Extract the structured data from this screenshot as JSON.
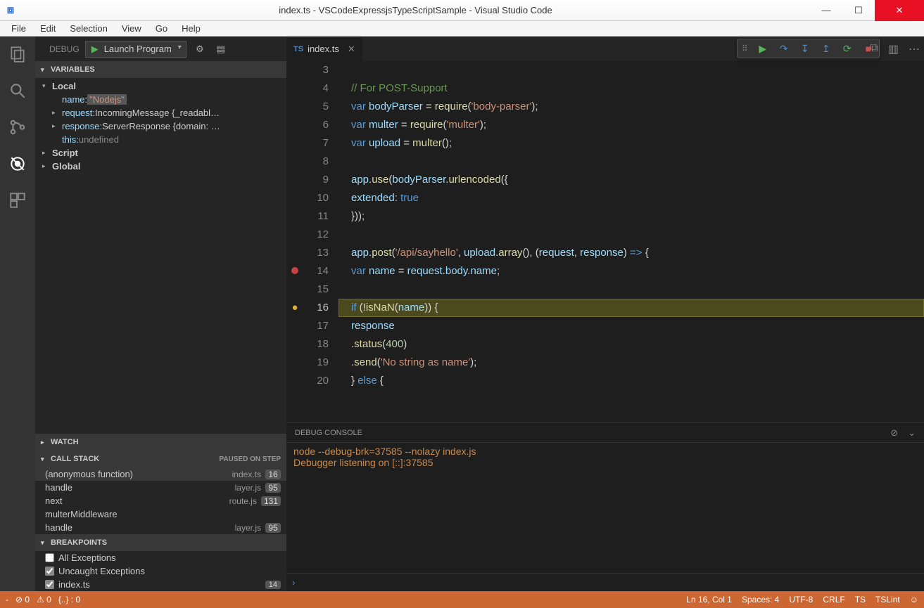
{
  "window": {
    "title": "index.ts - VSCodeExpressjsTypeScriptSample - Visual Studio Code"
  },
  "menu": [
    "File",
    "Edit",
    "Selection",
    "View",
    "Go",
    "Help"
  ],
  "debugTop": {
    "label": "DEBUG",
    "config": "Launch Program"
  },
  "sections": {
    "variables": "VARIABLES",
    "watch": "WATCH",
    "callstack": "CALL STACK",
    "callstack_state": "PAUSED ON STEP",
    "breakpoints": "BREAKPOINTS"
  },
  "variables": {
    "local_label": "Local",
    "rows": [
      {
        "indent": 2,
        "key": "name:",
        "val": "\"Nodejs\"",
        "hl": true
      },
      {
        "indent": 1,
        "chev": true,
        "key": "request:",
        "obj": "IncomingMessage {_readabl…"
      },
      {
        "indent": 1,
        "chev": true,
        "key": "response:",
        "obj": "ServerResponse {domain: …"
      },
      {
        "indent": 2,
        "key": "this:",
        "undef": "undefined"
      }
    ],
    "script_label": "Script",
    "global_label": "Global"
  },
  "callstack": [
    {
      "name": "(anonymous function)",
      "file": "index.ts",
      "line": "16",
      "active": true
    },
    {
      "name": "handle",
      "file": "layer.js",
      "line": "95"
    },
    {
      "name": "next",
      "file": "route.js",
      "line": "131"
    },
    {
      "name": "multerMiddleware",
      "file": "",
      "line": ""
    },
    {
      "name": "handle",
      "file": "layer.js",
      "line": "95"
    }
  ],
  "breakpoints": [
    {
      "label": "All Exceptions",
      "checked": false
    },
    {
      "label": "Uncaught Exceptions",
      "checked": true
    },
    {
      "label": "index.ts",
      "checked": true,
      "count": "14"
    }
  ],
  "tab": {
    "lang": "TS",
    "name": "index.ts"
  },
  "code_lines": [
    {
      "n": 3,
      "html": ""
    },
    {
      "n": 4,
      "html": "<span class='tk-com'>// For POST-Support</span>"
    },
    {
      "n": 5,
      "html": "<span class='tk-kw'>var</span> <span class='tk-var'>bodyParser</span> <span class='tk-pun'>=</span> <span class='tk-fn'>require</span><span class='tk-pun'>(</span><span class='tk-str'>'body-parser'</span><span class='tk-pun'>);</span>"
    },
    {
      "n": 6,
      "html": "<span class='tk-kw'>var</span> <span class='tk-var'>multer</span> <span class='tk-pun'>=</span> <span class='tk-fn'>require</span><span class='tk-pun'>(</span><span class='tk-str'>'multer'</span><span class='tk-pun'>);</span>"
    },
    {
      "n": 7,
      "html": "<span class='tk-kw'>var</span> <span class='tk-var'>upload</span> <span class='tk-pun'>=</span> <span class='tk-fn'>multer</span><span class='tk-pun'>();</span>"
    },
    {
      "n": 8,
      "html": ""
    },
    {
      "n": 9,
      "html": "<span class='tk-var'>app</span><span class='tk-pun'>.</span><span class='tk-fn'>use</span><span class='tk-pun'>(</span><span class='tk-var'>bodyParser</span><span class='tk-pun'>.</span><span class='tk-fn'>urlencoded</span><span class='tk-pun'>({</span>"
    },
    {
      "n": 10,
      "html": "    <span class='tk-var'>extended</span><span class='tk-pun'>:</span> <span class='tk-const'>true</span>"
    },
    {
      "n": 11,
      "html": "<span class='tk-pun'>}));</span>"
    },
    {
      "n": 12,
      "html": ""
    },
    {
      "n": 13,
      "html": "<span class='tk-var'>app</span><span class='tk-pun'>.</span><span class='tk-fn'>post</span><span class='tk-pun'>(</span><span class='tk-str'>'/api/sayhello'</span><span class='tk-pun'>,</span> <span class='tk-var'>upload</span><span class='tk-pun'>.</span><span class='tk-fn'>array</span><span class='tk-pun'>(), (</span><span class='tk-var'>request</span><span class='tk-pun'>,</span> <span class='tk-var'>response</span><span class='tk-pun'>)</span> <span class='tk-kw'>=&gt;</span> <span class='tk-pun'>{</span>"
    },
    {
      "n": 14,
      "glyph": "bp",
      "html": "    <span class='tk-kw'>var</span> <span class='tk-var'>name</span> <span class='tk-pun'>=</span> <span class='tk-var'>request</span><span class='tk-pun'>.</span><span class='tk-var'>body</span><span class='tk-pun'>.</span><span class='tk-var'>name</span><span class='tk-pun'>;</span>"
    },
    {
      "n": 15,
      "html": ""
    },
    {
      "n": 16,
      "glyph": "cur",
      "current": true,
      "html": "    <span class='tk-kw'>if</span> <span class='tk-pun'>(!</span><span class='tk-fn'>isNaN</span><span class='tk-pun'>(</span><span class='tk-var'>name</span><span class='tk-pun'>)) {</span>"
    },
    {
      "n": 17,
      "html": "        <span class='tk-var'>response</span>"
    },
    {
      "n": 18,
      "html": "            <span class='tk-pun'>.</span><span class='tk-fn'>status</span><span class='tk-pun'>(</span><span class='tk-num'>400</span><span class='tk-pun'>)</span>"
    },
    {
      "n": 19,
      "html": "            <span class='tk-pun'>.</span><span class='tk-fn'>send</span><span class='tk-pun'>(</span><span class='tk-str'>'No string as name'</span><span class='tk-pun'>);</span>"
    },
    {
      "n": 20,
      "html": "    <span class='tk-pun'>}</span> <span class='tk-kw'>else</span> <span class='tk-pun'>{</span>"
    }
  ],
  "panel": {
    "title": "DEBUG CONSOLE",
    "lines": [
      "node --debug-brk=37585 --nolazy index.js",
      "Debugger listening on [::]:37585"
    ]
  },
  "status": {
    "errors": "0",
    "warnings": "0",
    "braces": "{..} : 0",
    "pos": "Ln 16, Col 1",
    "spaces": "Spaces: 4",
    "encoding": "UTF-8",
    "eol": "CRLF",
    "lang": "TS",
    "lint": "TSLint"
  }
}
